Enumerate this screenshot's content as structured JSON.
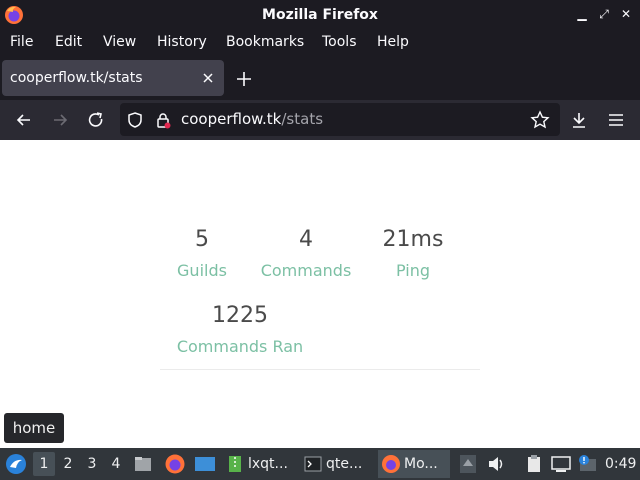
{
  "window": {
    "title": "Mozilla Firefox"
  },
  "menu": [
    {
      "label": "File"
    },
    {
      "label": "Edit"
    },
    {
      "label": "View"
    },
    {
      "label": "History"
    },
    {
      "label": "Bookmarks"
    },
    {
      "label": "Tools"
    },
    {
      "label": "Help"
    }
  ],
  "tab": {
    "title": "cooperflow.tk/stats"
  },
  "url": {
    "host": "cooperflow.tk",
    "path": "/stats"
  },
  "stats": [
    {
      "value": "5",
      "label": "Guilds"
    },
    {
      "value": "4",
      "label": "Commands"
    },
    {
      "value": "21ms",
      "label": "Ping"
    },
    {
      "value": "1225",
      "label": "Commands Ran"
    }
  ],
  "tooltip": {
    "text": "home"
  },
  "taskbar": {
    "desktops": [
      "1",
      "2",
      "3",
      "4"
    ],
    "tasks": [
      {
        "label": "lxqt..."
      },
      {
        "label": "qte..."
      },
      {
        "label": "Mo..."
      }
    ],
    "clock": "0:49"
  },
  "colors": {
    "accent": "#7cc0a4",
    "chrome": "#1c1b22",
    "toolbar": "#2b2a33"
  }
}
